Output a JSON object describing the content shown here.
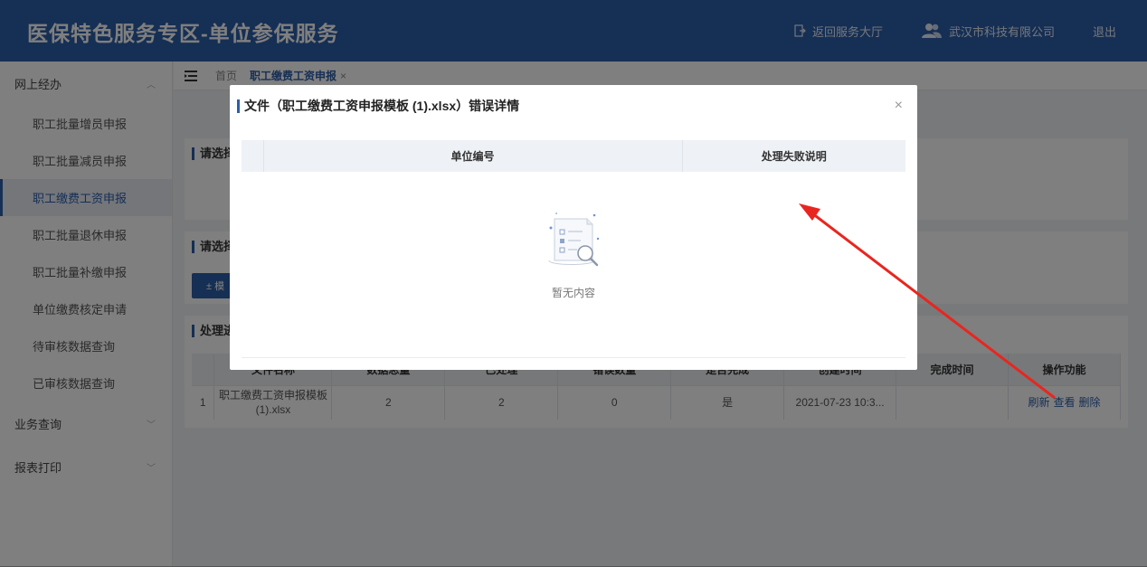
{
  "header": {
    "title": "医保特色服务专区-单位参保服务",
    "back_label": "返回服务大厅",
    "company": "武汉市科技有限公司",
    "logout_label": "退出"
  },
  "sidebar": {
    "groups": [
      {
        "label": "网上经办"
      },
      {
        "label": "业务查询"
      },
      {
        "label": "报表打印"
      }
    ],
    "items": [
      {
        "label": "职工批量增员申报"
      },
      {
        "label": "职工批量减员申报"
      },
      {
        "label": "职工缴费工资申报"
      },
      {
        "label": "职工批量退休申报"
      },
      {
        "label": "职工批量补缴申报"
      },
      {
        "label": "单位缴费核定申请"
      },
      {
        "label": "待审核数据查询"
      },
      {
        "label": "已审核数据查询"
      }
    ]
  },
  "tabs": [
    {
      "label": "首页"
    },
    {
      "label": "职工缴费工资申报",
      "close": "×"
    }
  ],
  "panels": [
    {
      "title": "请选择"
    },
    {
      "title": "请选择"
    },
    {
      "title": "处理进"
    }
  ],
  "import_button": "± 模",
  "table": {
    "columns": [
      "",
      "文件名称",
      "数据总量",
      "已处理",
      "错误数量",
      "是否完成",
      "创建时间",
      "完成时间",
      "操作功能"
    ],
    "rows": [
      {
        "index": "1",
        "file": "职工缴费工资申报模板 (1).xlsx",
        "total": "2",
        "processed": "2",
        "errors": "0",
        "done": "是",
        "created": "2021-07-23 10:3...",
        "finished": "",
        "actions": [
          "刷新",
          "查看",
          "删除"
        ]
      }
    ]
  },
  "modal": {
    "title": "文件（职工缴费工资申报模板 (1).xlsx）错误详情",
    "close": "×",
    "columns": [
      "",
      "单位编号",
      "处理失败说明"
    ],
    "empty_text": "暂无内容"
  },
  "colors": {
    "primary": "#2c5fa8",
    "arrow": "#e8261f"
  }
}
